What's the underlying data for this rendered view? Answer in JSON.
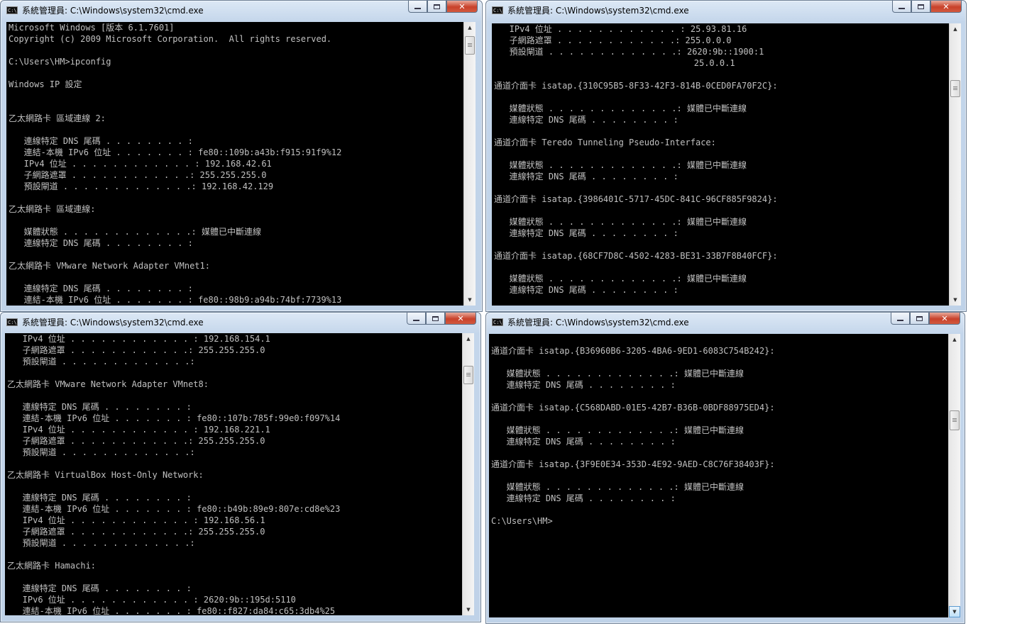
{
  "windows": [
    {
      "title": "系統管理員: C:\\Windows\\system32\\cmd.exe",
      "icon": "cmd-icon",
      "lines": [
        "Microsoft Windows [版本 6.1.7601]",
        "Copyright (c) 2009 Microsoft Corporation.  All rights reserved.",
        "",
        "C:\\Users\\HM>ipconfig",
        "",
        "Windows IP 設定",
        "",
        "",
        "乙太網路卡 區域連線 2:",
        "",
        "   連線特定 DNS 尾碼 . . . . . . . . :",
        "   連結-本機 IPv6 位址 . . . . . . . : fe80::109b:a43b:f915:91f9%12",
        "   IPv4 位址 . . . . . . . . . . . . : 192.168.42.61",
        "   子網路遮罩 . . . . . . . . . . . .: 255.255.255.0",
        "   預設閘道 . . . . . . . . . . . . .: 192.168.42.129",
        "",
        "乙太網路卡 區域連線:",
        "",
        "   媒體狀態 . . . . . . . . . . . . .: 媒體已中斷連線",
        "   連線特定 DNS 尾碼 . . . . . . . . :",
        "",
        "乙太網路卡 VMware Network Adapter VMnet1:",
        "",
        "   連線特定 DNS 尾碼 . . . . . . . . :",
        "   連結-本機 IPv6 位址 . . . . . . . : fe80::98b9:a94b:74bf:7739%13"
      ]
    },
    {
      "title": "系統管理員: C:\\Windows\\system32\\cmd.exe",
      "icon": "cmd-icon",
      "lines": [
        "   IPv4 位址 . . . . . . . . . . . . : 25.93.81.16",
        "   子網路遮罩 . . . . . . . . . . . .: 255.0.0.0",
        "   預設閘道 . . . . . . . . . . . . .: 2620:9b::1900:1",
        "                                       25.0.0.1",
        "",
        "通道介面卡 isatap.{310C95B5-8F33-42F3-814B-0CED0FA70F2C}:",
        "",
        "   媒體狀態 . . . . . . . . . . . . .: 媒體已中斷連線",
        "   連線特定 DNS 尾碼 . . . . . . . . :",
        "",
        "通道介面卡 Teredo Tunneling Pseudo-Interface:",
        "",
        "   媒體狀態 . . . . . . . . . . . . .: 媒體已中斷連線",
        "   連線特定 DNS 尾碼 . . . . . . . . :",
        "",
        "通道介面卡 isatap.{3986401C-5717-45DC-841C-96CF885F9824}:",
        "",
        "   媒體狀態 . . . . . . . . . . . . .: 媒體已中斷連線",
        "   連線特定 DNS 尾碼 . . . . . . . . :",
        "",
        "通道介面卡 isatap.{68CF7D8C-4502-4283-BE31-33B7F8B40FCF}:",
        "",
        "   媒體狀態 . . . . . . . . . . . . .: 媒體已中斷連線",
        "   連線特定 DNS 尾碼 . . . . . . . . :"
      ]
    },
    {
      "title": "系統管理員: C:\\Windows\\system32\\cmd.exe",
      "icon": "cmd-icon",
      "lines": [
        "   IPv4 位址 . . . . . . . . . . . . : 192.168.154.1",
        "   子網路遮罩 . . . . . . . . . . . .: 255.255.255.0",
        "   預設閘道 . . . . . . . . . . . . .:",
        "",
        "乙太網路卡 VMware Network Adapter VMnet8:",
        "",
        "   連線特定 DNS 尾碼 . . . . . . . . :",
        "   連結-本機 IPv6 位址 . . . . . . . : fe80::107b:785f:99e0:f097%14",
        "   IPv4 位址 . . . . . . . . . . . . : 192.168.221.1",
        "   子網路遮罩 . . . . . . . . . . . .: 255.255.255.0",
        "   預設閘道 . . . . . . . . . . . . .:",
        "",
        "乙太網路卡 VirtualBox Host-Only Network:",
        "",
        "   連線特定 DNS 尾碼 . . . . . . . . :",
        "   連結-本機 IPv6 位址 . . . . . . . : fe80::b49b:89e9:807e:cd8e%23",
        "   IPv4 位址 . . . . . . . . . . . . : 192.168.56.1",
        "   子網路遮罩 . . . . . . . . . . . .: 255.255.255.0",
        "   預設閘道 . . . . . . . . . . . . .:",
        "",
        "乙太網路卡 Hamachi:",
        "",
        "   連線特定 DNS 尾碼 . . . . . . . . :",
        "   IPv6 位址 . . . . . . . . . . . . : 2620:9b::195d:5110",
        "   連結-本機 IPv6 位址 . . . . . . . : fe80::f827:da84:c65:3db4%25"
      ]
    },
    {
      "title": "系統管理員: C:\\Windows\\system32\\cmd.exe",
      "icon": "cmd-icon",
      "lines": [
        "",
        "通道介面卡 isatap.{B36960B6-3205-4BA6-9ED1-6083C754B242}:",
        "",
        "   媒體狀態 . . . . . . . . . . . . .: 媒體已中斷連線",
        "   連線特定 DNS 尾碼 . . . . . . . . :",
        "",
        "通道介面卡 isatap.{C568DABD-01E5-42B7-B36B-0BDF88975ED4}:",
        "",
        "   媒體狀態 . . . . . . . . . . . . .: 媒體已中斷連線",
        "   連線特定 DNS 尾碼 . . . . . . . . :",
        "",
        "通道介面卡 isatap.{3F9E0E34-353D-4E92-9AED-C8C76F38403F}:",
        "",
        "   媒體狀態 . . . . . . . . . . . . .: 媒體已中斷連線",
        "   連線特定 DNS 尾碼 . . . . . . . . :",
        "",
        "C:\\Users\\HM>"
      ]
    }
  ]
}
